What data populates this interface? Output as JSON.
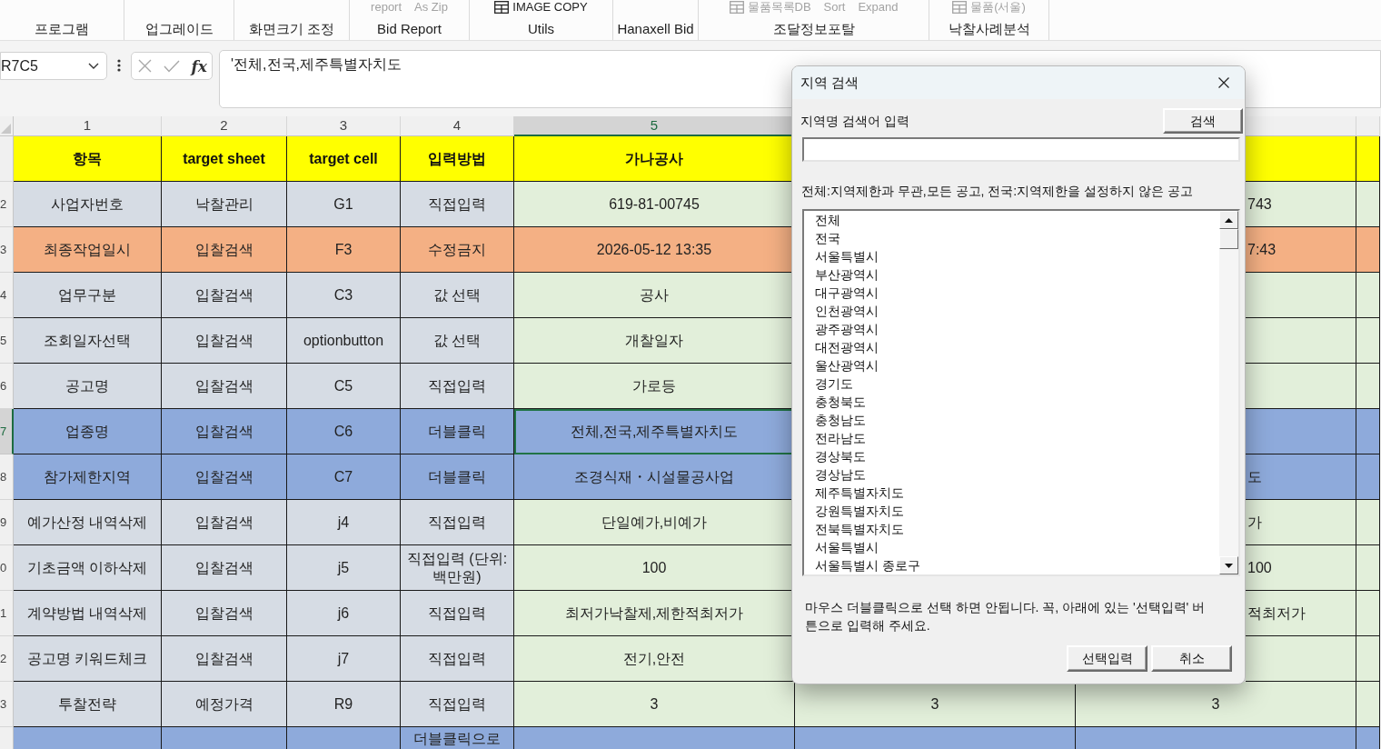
{
  "ribbon": {
    "groups": [
      {
        "label": "프로그램"
      },
      {
        "label": "업그레이드"
      },
      {
        "label": "화면크기 조정"
      },
      {
        "label": "Bid Report",
        "items": [
          {
            "kind": "text",
            "label": "report",
            "disabled": true
          },
          {
            "kind": "text",
            "label": "As Zip",
            "disabled": true
          }
        ]
      },
      {
        "label": "Utils",
        "items": [
          {
            "kind": "icon",
            "label": "IMAGE COPY",
            "disabled": false
          }
        ]
      },
      {
        "label": "Hanaxell Bid"
      },
      {
        "label": "조달정보포탈",
        "items": [
          {
            "kind": "icon",
            "label": "물품목록DB",
            "disabled": true
          },
          {
            "kind": "text",
            "label": "Sort",
            "disabled": true
          },
          {
            "kind": "text",
            "label": "Expand",
            "disabled": true
          }
        ]
      },
      {
        "label": "낙찰사례분석",
        "items": [
          {
            "kind": "icon",
            "label": "물품(서울)",
            "disabled": true
          }
        ]
      }
    ]
  },
  "formula_bar": {
    "name_box": "R7C5",
    "function_label": "fx",
    "formula": "'전체,전국,제주특별자치도"
  },
  "sheet": {
    "columns": [
      {
        "label": "1",
        "selected": false
      },
      {
        "label": "2",
        "selected": false
      },
      {
        "label": "3",
        "selected": false
      },
      {
        "label": "4",
        "selected": false
      },
      {
        "label": "5",
        "selected": true
      }
    ],
    "rows": [
      {
        "kind": "header",
        "selected": false,
        "cells": [
          "항목",
          "target sheet",
          "target cell",
          "입력방법",
          "가나공사"
        ]
      },
      {
        "number": "2",
        "kind": "plain",
        "selected": false,
        "cells": [
          "사업자번호",
          "낙찰관리",
          "G1",
          "직접입력",
          "619-81-00745",
          null,
          "743"
        ]
      },
      {
        "number": "3",
        "kind": "locked",
        "selected": false,
        "cells": [
          "최종작업일시",
          "입찰검색",
          "F3",
          "수정금지",
          "2026-05-12 13:35",
          null,
          "7:43"
        ]
      },
      {
        "number": "4",
        "kind": "plain",
        "selected": false,
        "cells": [
          "업무구분",
          "입찰검색",
          "C3",
          "값 선택",
          "공사"
        ]
      },
      {
        "number": "5",
        "kind": "plain",
        "selected": false,
        "cells": [
          "조회일자선택",
          "입찰검색",
          "optionbutton",
          "값 선택",
          "개찰일자"
        ]
      },
      {
        "number": "6",
        "kind": "plain",
        "selected": false,
        "cells": [
          "공고명",
          "입찰검색",
          "C5",
          "직접입력",
          "가로등"
        ]
      },
      {
        "number": "7",
        "kind": "highlight",
        "selected": true,
        "cells": [
          "업종명",
          "입찰검색",
          "C6",
          "더블클릭",
          "전체,전국,제주특별자치도"
        ]
      },
      {
        "number": "8",
        "kind": "highlight",
        "selected": false,
        "cells": [
          "참가제한지역",
          "입찰검색",
          "C7",
          "더블클릭",
          "조경식재・시설물공사업",
          null,
          "도"
        ]
      },
      {
        "number": "9",
        "kind": "plain",
        "selected": false,
        "cells": [
          "예가산정 내역삭제",
          "입찰검색",
          "j4",
          "직접입력",
          "단일예가,비예가",
          null,
          "가"
        ]
      },
      {
        "number": "0",
        "kind": "plain",
        "selected": false,
        "cells": [
          "기초금액 이하삭제",
          "입찰검색",
          "j5",
          "직접입력 (단위:백만원)",
          "100",
          null,
          "100"
        ]
      },
      {
        "number": "1",
        "kind": "plain",
        "selected": false,
        "cells": [
          "계약방법 내역삭제",
          "입찰검색",
          "j6",
          "직접입력",
          "최저가낙찰제,제한적최저가",
          null,
          "적최저가"
        ]
      },
      {
        "number": "2",
        "kind": "plain",
        "selected": false,
        "cells": [
          "공고명 키워드체크",
          "입찰검색",
          "j7",
          "직접입력",
          "전기,안전"
        ]
      },
      {
        "number": "3",
        "kind": "plain",
        "selected": false,
        "cells": [
          "투찰전략",
          "예정가격",
          "R9",
          "직접입력",
          "3",
          "3",
          "3"
        ]
      },
      {
        "kind": "highlight",
        "selected": false,
        "cells": [
          null,
          null,
          null,
          "더블클릭으로"
        ]
      }
    ]
  },
  "dialog": {
    "title": "지역 검색",
    "search_label": "지역명 검색어 입력",
    "search_button": "검색",
    "note": "전체:지역제한과 무관,모든 공고, 전국:지역제한을 설정하지 않은 공고",
    "regions": [
      {
        "label": "전체",
        "selected": false
      },
      {
        "label": "전국",
        "selected": false
      },
      {
        "label": "서울특별시",
        "selected": false
      },
      {
        "label": "부산광역시",
        "selected": false
      },
      {
        "label": "대구광역시",
        "selected": false
      },
      {
        "label": "인천광역시",
        "selected": false
      },
      {
        "label": "광주광역시",
        "selected": false
      },
      {
        "label": "대전광역시",
        "selected": false
      },
      {
        "label": "울산광역시",
        "selected": false
      },
      {
        "label": "경기도",
        "selected": false
      },
      {
        "label": "충청북도",
        "selected": false
      },
      {
        "label": "충청남도",
        "selected": false
      },
      {
        "label": "전라남도",
        "selected": false
      },
      {
        "label": "경상북도",
        "selected": false
      },
      {
        "label": "경상남도",
        "selected": false
      },
      {
        "label": "제주특별자치도",
        "selected": false
      },
      {
        "label": "강원특별자치도",
        "selected": false
      },
      {
        "label": "전북특별자치도",
        "selected": false
      },
      {
        "label": "서울특별시",
        "selected": false
      },
      {
        "label": "서울특별시 종로구",
        "selected": false
      }
    ],
    "message": "마우스 더블클릭으로 선택 하면 안됩니다. 꼭, 아래에 있는 '선택입력' 버튼으로 입력해 주세요.",
    "buttons": [
      "선택입력",
      "취소"
    ]
  }
}
